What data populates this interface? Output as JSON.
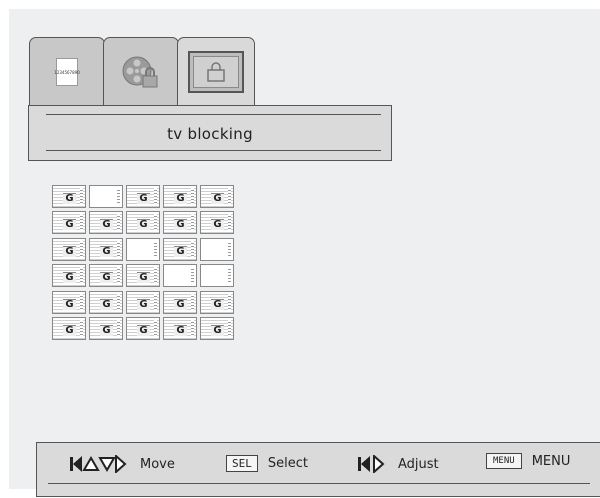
{
  "tabs": [
    {
      "name": "channel-tab",
      "icon": "numpad-icon",
      "digits": [
        "1",
        "2",
        "3",
        "4",
        "5",
        "6",
        "7",
        "8",
        "9",
        "0"
      ]
    },
    {
      "name": "setup-tab",
      "icon": "film-reel-lock-icon"
    },
    {
      "name": "ratings-tab",
      "icon": "tv-lock-icon",
      "active": true
    }
  ],
  "panel": {
    "title": "tv blocking"
  },
  "rating_grid": {
    "rows": 6,
    "cols": 5,
    "cell_label": "G",
    "on": [
      [
        true,
        false,
        true,
        true,
        true
      ],
      [
        true,
        true,
        true,
        true,
        true
      ],
      [
        true,
        true,
        false,
        true,
        false
      ],
      [
        true,
        true,
        true,
        false,
        false
      ],
      [
        true,
        true,
        true,
        true,
        true
      ],
      [
        true,
        true,
        true,
        true,
        true
      ]
    ]
  },
  "footer": {
    "move_label": "Move",
    "select_key": "SEL",
    "select_label": "Select",
    "adjust_label": "Adjust",
    "menu_key": "MENU",
    "menu_label": "MENU"
  }
}
